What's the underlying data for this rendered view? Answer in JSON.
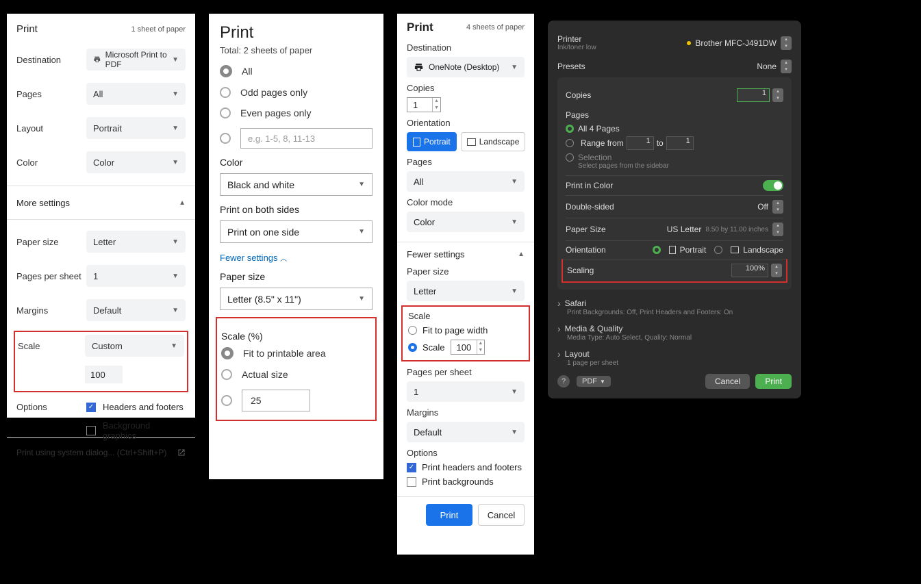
{
  "p1": {
    "title": "Print",
    "sheets": "1 sheet of paper",
    "destination_label": "Destination",
    "destination_value": "Microsoft Print to PDF",
    "pages_label": "Pages",
    "pages_value": "All",
    "layout_label": "Layout",
    "layout_value": "Portrait",
    "color_label": "Color",
    "color_value": "Color",
    "more_settings": "More settings",
    "paper_size_label": "Paper size",
    "paper_size_value": "Letter",
    "pps_label": "Pages per sheet",
    "pps_value": "1",
    "margins_label": "Margins",
    "margins_value": "Default",
    "scale_label": "Scale",
    "scale_value": "Custom",
    "scale_input": "100",
    "options_label": "Options",
    "hf": "Headers and footers",
    "bg": "Background graphics",
    "sys": "Print using system dialog... (Ctrl+Shift+P)"
  },
  "p2": {
    "title": "Print",
    "total": "Total: 2 sheets of paper",
    "all": "All",
    "odd": "Odd pages only",
    "even": "Even pages only",
    "ph": "e.g. 1-5, 8, 11-13",
    "color_label": "Color",
    "color_value": "Black and white",
    "bothsides_label": "Print on both sides",
    "bothsides_value": "Print on one side",
    "fewer": "Fewer settings",
    "paper_label": "Paper size",
    "paper_value": "Letter (8.5\" x 11\")",
    "scalepct": "Scale (%)",
    "fit": "Fit to printable area",
    "actual": "Actual size",
    "custom_value": "25"
  },
  "p3": {
    "title": "Print",
    "sheets": "4 sheets of paper",
    "dest_label": "Destination",
    "dest_value": "OneNote (Desktop)",
    "copies_label": "Copies",
    "copies_value": "1",
    "orient_label": "Orientation",
    "portrait": "Portrait",
    "landscape": "Landscape",
    "pages_label": "Pages",
    "pages_value": "All",
    "colormode_label": "Color mode",
    "colormode_value": "Color",
    "fewer": "Fewer settings",
    "paper_label": "Paper size",
    "paper_value": "Letter",
    "scale_label": "Scale",
    "fit": "Fit to page width",
    "scale_opt": "Scale",
    "scale_value": "100",
    "pps_label": "Pages per sheet",
    "pps_value": "1",
    "margins_label": "Margins",
    "margins_value": "Default",
    "options_label": "Options",
    "hf": "Print headers and footers",
    "bg": "Print backgrounds",
    "print_btn": "Print",
    "cancel_btn": "Cancel"
  },
  "p4": {
    "printer_label": "Printer",
    "ink_status": "Ink/toner low",
    "printer_value": "Brother MFC-J491DW",
    "presets_label": "Presets",
    "presets_value": "None",
    "copies_label": "Copies",
    "copies_value": "1",
    "pages_label": "Pages",
    "all4": "All 4 Pages",
    "range_from": "Range from",
    "range_from_v": "1",
    "range_to": "to",
    "range_to_v": "1",
    "selection": "Selection",
    "selection_hint": "Select pages from the sidebar",
    "color_label": "Print in Color",
    "double_label": "Double-sided",
    "double_value": "Off",
    "papersize_label": "Paper Size",
    "papersize_value": "US Letter",
    "papersize_dims": "8.50 by 11.00 inches",
    "orient_label": "Orientation",
    "orient_portrait": "Portrait",
    "orient_landscape": "Landscape",
    "scaling_label": "Scaling",
    "scaling_value": "100%",
    "safari_label": "Safari",
    "safari_hint": "Print Backgrounds: Off, Print Headers and Footers: On",
    "media_label": "Media & Quality",
    "media_hint": "Media Type: Auto Select, Quality: Normal",
    "layout_label": "Layout",
    "layout_hint": "1 page per sheet",
    "pdf_btn": "PDF",
    "cancel_btn": "Cancel",
    "print_btn": "Print"
  }
}
